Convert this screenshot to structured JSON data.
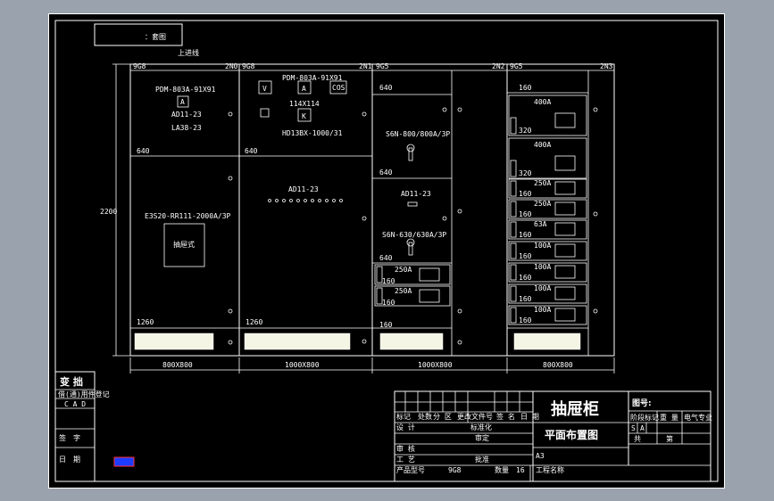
{
  "drawing": {
    "header_label": "：套图",
    "top_note": "上进线",
    "height_label": "2200",
    "cabinets": [
      {
        "code": "9G8",
        "number": "2N0",
        "meter_type": "PDM-803A-91X91",
        "box_a": "A",
        "ad": "AD11-23",
        "la": "LA38-23",
        "dim_top": "640",
        "breaker": "E3S20-RR111-2000A/3P",
        "breaker_box": "抽屉式",
        "dim_bottom": "1260",
        "width_label": "800X800"
      },
      {
        "code": "9G8",
        "number": "2N1",
        "meter_type": "PDM-803A-91X91",
        "box_v": "V",
        "box_a": "A",
        "box_cos": "COS",
        "size_label": "114X114",
        "box_k": "K",
        "switch": "HD13BX-1000/31",
        "dim_top": "640",
        "ad": "AD11-23",
        "dim_bottom": "1260",
        "width_label": "1000X800"
      },
      {
        "code": "9G5",
        "number": "2N2",
        "dim_640a": "640",
        "switch_top": "S6N-800/800A/3P",
        "dim_640b": "640",
        "ad": "AD11-23",
        "switch_mid": "S6N-630/630A/3P",
        "dim_640c": "640",
        "drawers": [
          {
            "rating": "250A",
            "height": "160"
          },
          {
            "rating": "250A",
            "height": "160"
          }
        ],
        "dim_160": "160",
        "width_label": "1000X800"
      },
      {
        "code": "9G5",
        "number": "2N3",
        "dim_160": "160",
        "large_drawers": [
          {
            "rating": "400A",
            "height": "320"
          },
          {
            "rating": "400A",
            "height": "320"
          }
        ],
        "small_drawers": [
          {
            "rating": "250A",
            "height": "160"
          },
          {
            "rating": "250A",
            "height": "160"
          },
          {
            "rating": "63A",
            "height": "160"
          },
          {
            "rating": "100A",
            "height": "160"
          },
          {
            "rating": "100A",
            "height": "160"
          },
          {
            "rating": "100A",
            "height": "160"
          },
          {
            "rating": "100A",
            "height": "160"
          }
        ],
        "width_label": "800X800"
      }
    ]
  },
  "left_block": {
    "title": "变 拙",
    "row1": "借(通)用件登记",
    "row2": "C A D",
    "row3": "签　字",
    "row4": "日　期"
  },
  "title_block": {
    "product_title": "抽屉柜",
    "subtitle": "平面布置图",
    "drawing_no_label": "图号:",
    "size": "A3",
    "row_mark": [
      "标记",
      "处数",
      "分 区",
      "更改文件号",
      "签 名",
      "日 期"
    ],
    "design": "设 计",
    "standardize": "标准化",
    "check": "审 核",
    "review": "审定",
    "process": "工 艺",
    "approve": "批准",
    "product_model_label": "产品型号",
    "product_model_value": "9G8",
    "quantity_label": "数量",
    "quantity_value": "16",
    "project_label": "工程名称",
    "stage_label": "阶段标记",
    "weight_label": "重 量",
    "scale_label": "电气专业",
    "stage_s": "S",
    "stage_a": "A",
    "total_label": "共",
    "page_label": "第"
  },
  "colors": {
    "background": "#9aa3ad",
    "sheet": "#000000",
    "lines": "#ffffff",
    "marker": "#1e3cff"
  }
}
